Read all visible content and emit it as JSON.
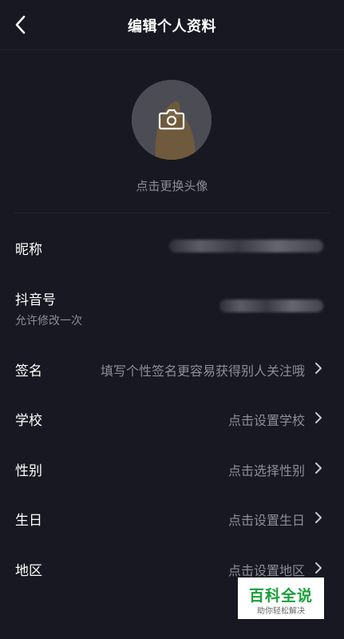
{
  "header": {
    "title": "编辑个人资料",
    "back_icon": "chevron-left-icon"
  },
  "avatar": {
    "caption": "点击更换头像",
    "camera_icon": "camera-icon"
  },
  "fields": {
    "nickname": {
      "label": "昵称",
      "value": ""
    },
    "douyin_id": {
      "label": "抖音号",
      "sub": "允许修改一次",
      "value": ""
    },
    "signature": {
      "label": "签名",
      "value": "填写个性签名更容易获得别人关注哦"
    },
    "school": {
      "label": "学校",
      "value": "点击设置学校"
    },
    "gender": {
      "label": "性别",
      "value": "点击选择性别"
    },
    "birthday": {
      "label": "生日",
      "value": "点击设置生日"
    },
    "region": {
      "label": "地区",
      "value": "点击设置地区"
    }
  },
  "watermark": {
    "title": "百科全说",
    "subtitle": "助你轻松解决"
  },
  "colors": {
    "background": "#171821",
    "text_primary": "#ffffff",
    "text_secondary": "#8c8d95",
    "watermark_green": "#1aa03a"
  }
}
